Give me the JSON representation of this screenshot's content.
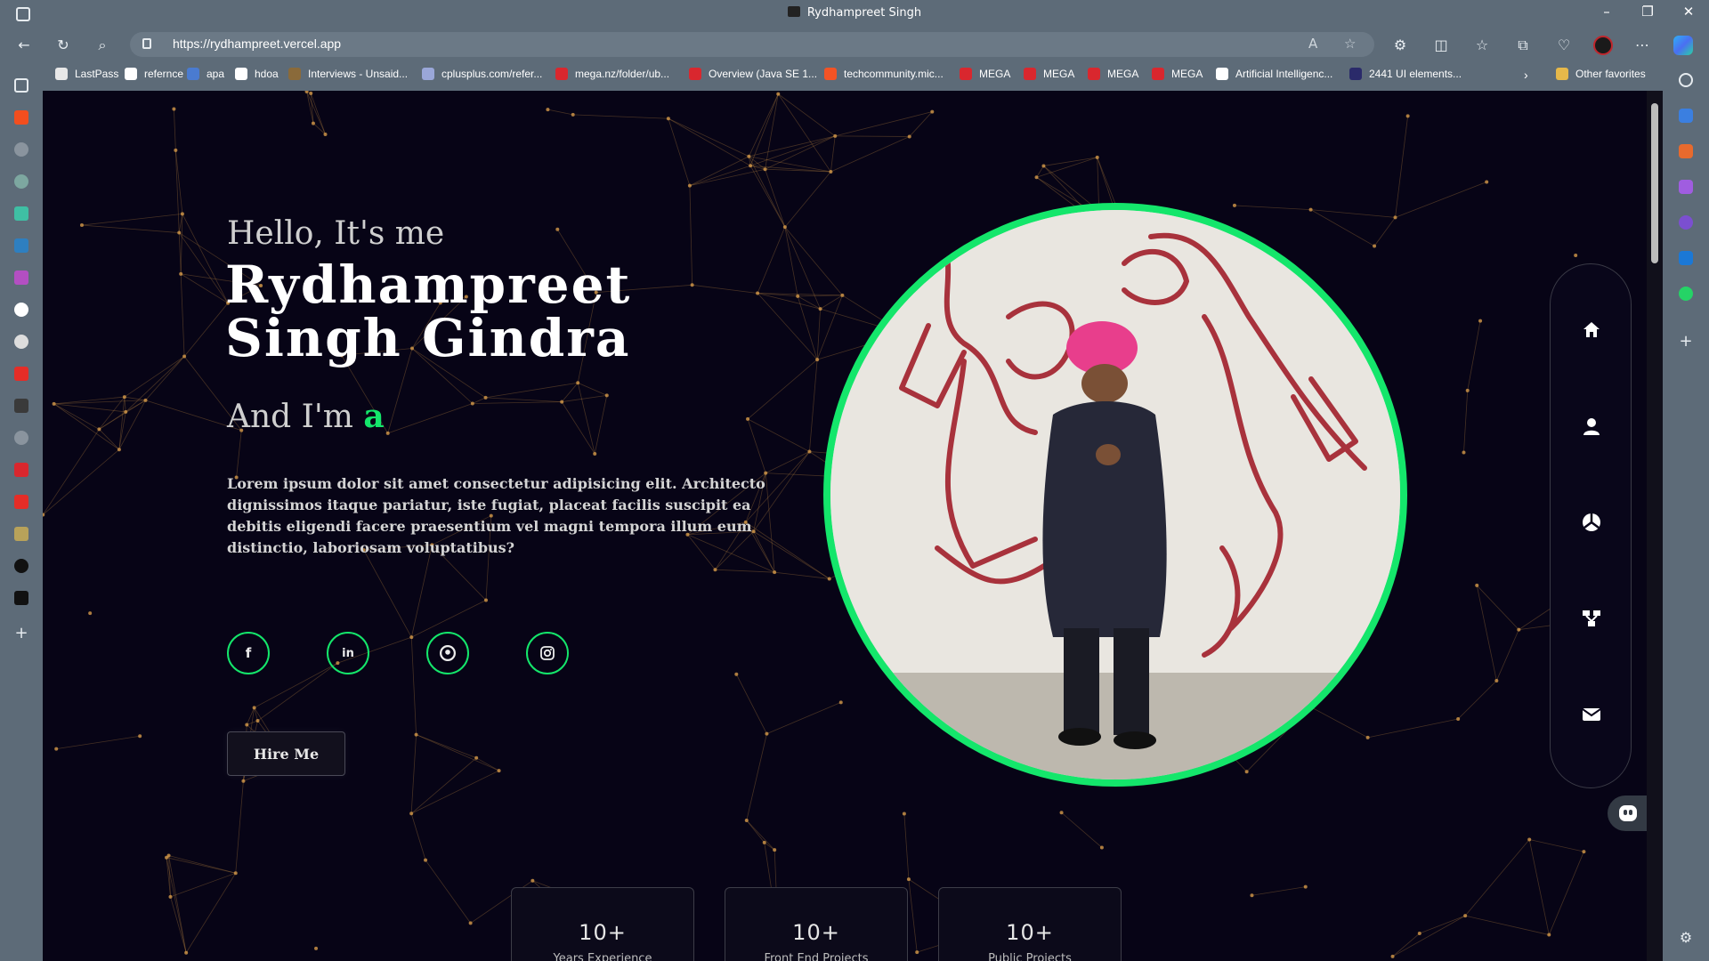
{
  "browser": {
    "window_title": "Rydhampreet Singh",
    "url": "https://rydhampreet.vercel.app",
    "favorites": [
      {
        "label": "LastPass",
        "icon": "page-icon",
        "color": "#e8e8e8"
      },
      {
        "label": "refernce",
        "icon": "amazon-icon",
        "color": "#ffffff"
      },
      {
        "label": "apa",
        "icon": "apa-icon",
        "color": "#4a7bd0"
      },
      {
        "label": "hdoa",
        "icon": "google-icon",
        "color": "#ffffff"
      },
      {
        "label": "Interviews - Unsaid...",
        "icon": "book-icon",
        "color": "#8a6a3a"
      },
      {
        "label": "cplusplus.com/refer...",
        "icon": "cpp-icon",
        "color": "#9aa7d9"
      },
      {
        "label": "mega.nz/folder/ub...",
        "icon": "mega-icon",
        "color": "#d9272e"
      },
      {
        "label": "Overview (Java SE 1...",
        "icon": "oracle-icon",
        "color": "#d9272e"
      },
      {
        "label": "techcommunity.mic...",
        "icon": "microsoft-icon",
        "color": "#f35325"
      },
      {
        "label": "MEGA",
        "icon": "mega-icon",
        "color": "#d9272e"
      },
      {
        "label": "MEGA",
        "icon": "mega-icon",
        "color": "#d9272e"
      },
      {
        "label": "MEGA",
        "icon": "mega-icon",
        "color": "#d9272e"
      },
      {
        "label": "MEGA",
        "icon": "mega-icon",
        "color": "#d9272e"
      },
      {
        "label": "Artificial Intelligenc...",
        "icon": "ai-icon",
        "color": "#ffffff"
      },
      {
        "label": "2441 UI elements...",
        "icon": "ui-icon",
        "color": "#2a2a6a"
      }
    ],
    "other_favorites": "Other favorites"
  },
  "hero": {
    "greeting": "Hello, It's me",
    "name_line1": "Rydhampreet",
    "name_line2": "Singh Gindra",
    "role_prefix": "And I'm",
    "role_word": "a",
    "description": "Lorem ipsum dolor sit amet consectetur adipisicing elit. Architecto dignissimos itaque pariatur, iste fugiat, placeat facilis suscipit ea debitis eligendi facere praesentium vel magni tempora illum eum distinctio, laboriosam voluptatibus?",
    "social": [
      "facebook-icon",
      "linkedin-icon",
      "github-icon",
      "instagram-icon"
    ],
    "hire_label": "Hire Me",
    "accent_color": "#14e66b"
  },
  "sidenav": [
    "home-icon",
    "user-icon",
    "skills-icon",
    "projects-icon",
    "mail-icon"
  ],
  "stats": [
    {
      "value": "10+",
      "label": "Years Experience"
    },
    {
      "value": "10+",
      "label": "Front End Projects"
    },
    {
      "value": "10+",
      "label": "Public Projects"
    }
  ]
}
